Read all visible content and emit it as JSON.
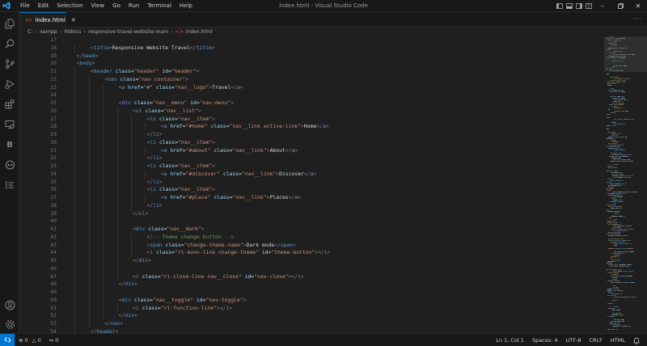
{
  "titlebar": {
    "menu": [
      "File",
      "Edit",
      "Selection",
      "View",
      "Go",
      "Run",
      "Terminal",
      "Help"
    ],
    "window_title": "index.html - Visual Studio Code"
  },
  "tabs": [
    {
      "label": "index.html",
      "active": true
    }
  ],
  "breadcrumb": [
    "C:",
    "xampp",
    "htdocs",
    "responsive-travel-website-main",
    "index.html"
  ],
  "editor": {
    "line_numbers": [
      "17",
      "18",
      "19",
      "20",
      "21",
      "22",
      "23",
      "24",
      "25",
      "26",
      "27",
      "28",
      "29",
      "30",
      "31",
      "32",
      "33",
      "34",
      "35",
      "36",
      "37",
      "38",
      "39",
      "40",
      "41",
      "42",
      "43",
      "44",
      "45",
      "46",
      "47",
      "48",
      "49",
      "50",
      "51",
      "52",
      "53",
      "54"
    ],
    "lines": [
      {
        "indent": 0,
        "tokens": []
      },
      {
        "indent": 2,
        "tokens": [
          [
            "br",
            "<"
          ],
          [
            "tag",
            "title"
          ],
          [
            "br",
            ">"
          ],
          [
            "txt",
            "Responsive Website Travel"
          ],
          [
            "br",
            "</"
          ],
          [
            "tag",
            "title"
          ],
          [
            "br",
            ">"
          ]
        ]
      },
      {
        "indent": 1,
        "tokens": [
          [
            "br",
            "</"
          ],
          [
            "tag",
            "head"
          ],
          [
            "br",
            ">"
          ]
        ]
      },
      {
        "indent": 1,
        "tokens": [
          [
            "br",
            "<"
          ],
          [
            "tag",
            "body"
          ],
          [
            "br",
            ">"
          ]
        ]
      },
      {
        "indent": 2,
        "tokens": [
          [
            "br",
            "<"
          ],
          [
            "tag",
            "header"
          ],
          [
            "txt",
            " "
          ],
          [
            "attr",
            "class"
          ],
          [
            "eq",
            "="
          ],
          [
            "str",
            "\"header\""
          ],
          [
            "txt",
            " "
          ],
          [
            "attr",
            "id"
          ],
          [
            "eq",
            "="
          ],
          [
            "str",
            "\"header\""
          ],
          [
            "br",
            ">"
          ]
        ]
      },
      {
        "indent": 3,
        "tokens": [
          [
            "br",
            "<"
          ],
          [
            "tag",
            "nav"
          ],
          [
            "txt",
            " "
          ],
          [
            "attr",
            "class"
          ],
          [
            "eq",
            "="
          ],
          [
            "str",
            "\"nav container\""
          ],
          [
            "br",
            ">"
          ]
        ]
      },
      {
        "indent": 4,
        "tokens": [
          [
            "br",
            "<"
          ],
          [
            "tag",
            "a"
          ],
          [
            "txt",
            " "
          ],
          [
            "attr",
            "href"
          ],
          [
            "eq",
            "="
          ],
          [
            "str",
            "\"#\""
          ],
          [
            "txt",
            " "
          ],
          [
            "attr",
            "class"
          ],
          [
            "eq",
            "="
          ],
          [
            "str",
            "\"nav__logo\""
          ],
          [
            "br",
            ">"
          ],
          [
            "txt",
            "Travel"
          ],
          [
            "br",
            "</"
          ],
          [
            "tag",
            "a"
          ],
          [
            "br",
            ">"
          ]
        ]
      },
      {
        "indent": 0,
        "tokens": []
      },
      {
        "indent": 4,
        "tokens": [
          [
            "br",
            "<"
          ],
          [
            "tag",
            "div"
          ],
          [
            "txt",
            " "
          ],
          [
            "attr",
            "class"
          ],
          [
            "eq",
            "="
          ],
          [
            "str",
            "\"nav__menu\""
          ],
          [
            "txt",
            " "
          ],
          [
            "attr",
            "id"
          ],
          [
            "eq",
            "="
          ],
          [
            "str",
            "\"nav-menu\""
          ],
          [
            "br",
            ">"
          ]
        ]
      },
      {
        "indent": 5,
        "tokens": [
          [
            "br",
            "<"
          ],
          [
            "tag",
            "ul"
          ],
          [
            "txt",
            " "
          ],
          [
            "attr",
            "class"
          ],
          [
            "eq",
            "="
          ],
          [
            "str",
            "\"nav__list\""
          ],
          [
            "br",
            ">"
          ]
        ]
      },
      {
        "indent": 6,
        "tokens": [
          [
            "br",
            "<"
          ],
          [
            "tag",
            "li"
          ],
          [
            "txt",
            " "
          ],
          [
            "attr",
            "class"
          ],
          [
            "eq",
            "="
          ],
          [
            "str",
            "\"nav__item\""
          ],
          [
            "br",
            ">"
          ]
        ]
      },
      {
        "indent": 7,
        "tokens": [
          [
            "br",
            "<"
          ],
          [
            "tag",
            "a"
          ],
          [
            "txt",
            " "
          ],
          [
            "attr",
            "href"
          ],
          [
            "eq",
            "="
          ],
          [
            "str",
            "\"#home\""
          ],
          [
            "txt",
            " "
          ],
          [
            "attr",
            "class"
          ],
          [
            "eq",
            "="
          ],
          [
            "str",
            "\"nav__link active-link\""
          ],
          [
            "br",
            ">"
          ],
          [
            "txt",
            "Home"
          ],
          [
            "br",
            "</"
          ],
          [
            "tag",
            "a"
          ],
          [
            "br",
            ">"
          ]
        ]
      },
      {
        "indent": 6,
        "tokens": [
          [
            "br",
            "</"
          ],
          [
            "tag",
            "li"
          ],
          [
            "br",
            ">"
          ]
        ]
      },
      {
        "indent": 6,
        "tokens": [
          [
            "br",
            "<"
          ],
          [
            "tag",
            "li"
          ],
          [
            "txt",
            " "
          ],
          [
            "attr",
            "class"
          ],
          [
            "eq",
            "="
          ],
          [
            "str",
            "\"nav__item\""
          ],
          [
            "br",
            ">"
          ]
        ]
      },
      {
        "indent": 7,
        "tokens": [
          [
            "br",
            "<"
          ],
          [
            "tag",
            "a"
          ],
          [
            "txt",
            " "
          ],
          [
            "attr",
            "href"
          ],
          [
            "eq",
            "="
          ],
          [
            "str",
            "\"#about\""
          ],
          [
            "txt",
            " "
          ],
          [
            "attr",
            "class"
          ],
          [
            "eq",
            "="
          ],
          [
            "str",
            "\"nav__link\""
          ],
          [
            "br",
            ">"
          ],
          [
            "txt",
            "About"
          ],
          [
            "br",
            "</"
          ],
          [
            "tag",
            "a"
          ],
          [
            "br",
            ">"
          ]
        ]
      },
      {
        "indent": 6,
        "tokens": [
          [
            "br",
            "</"
          ],
          [
            "tag",
            "li"
          ],
          [
            "br",
            ">"
          ]
        ]
      },
      {
        "indent": 6,
        "tokens": [
          [
            "br",
            "<"
          ],
          [
            "tag",
            "li"
          ],
          [
            "txt",
            " "
          ],
          [
            "attr",
            "class"
          ],
          [
            "eq",
            "="
          ],
          [
            "str",
            "\"nav__item\""
          ],
          [
            "br",
            ">"
          ]
        ]
      },
      {
        "indent": 7,
        "tokens": [
          [
            "br",
            "<"
          ],
          [
            "tag",
            "a"
          ],
          [
            "txt",
            " "
          ],
          [
            "attr",
            "href"
          ],
          [
            "eq",
            "="
          ],
          [
            "str",
            "\"#discover\""
          ],
          [
            "txt",
            " "
          ],
          [
            "attr",
            "class"
          ],
          [
            "eq",
            "="
          ],
          [
            "str",
            "\"nav__link\""
          ],
          [
            "br",
            ">"
          ],
          [
            "txt",
            "Discover"
          ],
          [
            "br",
            "</"
          ],
          [
            "tag",
            "a"
          ],
          [
            "br",
            ">"
          ]
        ]
      },
      {
        "indent": 6,
        "tokens": [
          [
            "br",
            "</"
          ],
          [
            "tag",
            "li"
          ],
          [
            "br",
            ">"
          ]
        ]
      },
      {
        "indent": 6,
        "tokens": [
          [
            "br",
            "<"
          ],
          [
            "tag",
            "li"
          ],
          [
            "txt",
            " "
          ],
          [
            "attr",
            "class"
          ],
          [
            "eq",
            "="
          ],
          [
            "str",
            "\"nav__item\""
          ],
          [
            "br",
            ">"
          ]
        ]
      },
      {
        "indent": 7,
        "tokens": [
          [
            "br",
            "<"
          ],
          [
            "tag",
            "a"
          ],
          [
            "txt",
            " "
          ],
          [
            "attr",
            "href"
          ],
          [
            "eq",
            "="
          ],
          [
            "str",
            "\"#place\""
          ],
          [
            "txt",
            " "
          ],
          [
            "attr",
            "class"
          ],
          [
            "eq",
            "="
          ],
          [
            "str",
            "\"nav__link\""
          ],
          [
            "br",
            ">"
          ],
          [
            "txt",
            "Places"
          ],
          [
            "br",
            "</"
          ],
          [
            "tag",
            "a"
          ],
          [
            "br",
            ">"
          ]
        ]
      },
      {
        "indent": 6,
        "tokens": [
          [
            "br",
            "</"
          ],
          [
            "tag",
            "li"
          ],
          [
            "br",
            ">"
          ]
        ]
      },
      {
        "indent": 5,
        "tokens": [
          [
            "br",
            "</"
          ],
          [
            "tag",
            "ul"
          ],
          [
            "br",
            ">"
          ]
        ]
      },
      {
        "indent": 0,
        "tokens": []
      },
      {
        "indent": 5,
        "tokens": [
          [
            "br",
            "<"
          ],
          [
            "tag",
            "div"
          ],
          [
            "txt",
            " "
          ],
          [
            "attr",
            "class"
          ],
          [
            "eq",
            "="
          ],
          [
            "str",
            "\"nav__dark\""
          ],
          [
            "br",
            ">"
          ]
        ]
      },
      {
        "indent": 6,
        "tokens": [
          [
            "com",
            "<!-- Theme change button -->"
          ]
        ]
      },
      {
        "indent": 6,
        "tokens": [
          [
            "br",
            "<"
          ],
          [
            "tag",
            "span"
          ],
          [
            "txt",
            " "
          ],
          [
            "attr",
            "class"
          ],
          [
            "eq",
            "="
          ],
          [
            "str",
            "\"change-theme-name\""
          ],
          [
            "br",
            ">"
          ],
          [
            "txt",
            "Dark mode"
          ],
          [
            "br",
            "</"
          ],
          [
            "tag",
            "span"
          ],
          [
            "br",
            ">"
          ]
        ]
      },
      {
        "indent": 6,
        "tokens": [
          [
            "br",
            "<"
          ],
          [
            "tag",
            "i"
          ],
          [
            "txt",
            " "
          ],
          [
            "attr",
            "class"
          ],
          [
            "eq",
            "="
          ],
          [
            "str",
            "\"ri-moon-line change-theme\""
          ],
          [
            "txt",
            " "
          ],
          [
            "attr",
            "id"
          ],
          [
            "eq",
            "="
          ],
          [
            "str",
            "\"theme-button\""
          ],
          [
            "br",
            ">"
          ],
          [
            "br",
            "</"
          ],
          [
            "tag",
            "i"
          ],
          [
            "br",
            ">"
          ]
        ]
      },
      {
        "indent": 5,
        "tokens": [
          [
            "br",
            "</"
          ],
          [
            "tag",
            "div"
          ],
          [
            "br",
            ">"
          ]
        ]
      },
      {
        "indent": 0,
        "tokens": []
      },
      {
        "indent": 5,
        "tokens": [
          [
            "br",
            "<"
          ],
          [
            "tag",
            "i"
          ],
          [
            "txt",
            " "
          ],
          [
            "attr",
            "class"
          ],
          [
            "eq",
            "="
          ],
          [
            "str",
            "\"ri-close-line nav__close\""
          ],
          [
            "txt",
            " "
          ],
          [
            "attr",
            "id"
          ],
          [
            "eq",
            "="
          ],
          [
            "str",
            "\"nav-close\""
          ],
          [
            "br",
            ">"
          ],
          [
            "br",
            "</"
          ],
          [
            "tag",
            "i"
          ],
          [
            "br",
            ">"
          ]
        ]
      },
      {
        "indent": 4,
        "tokens": [
          [
            "br",
            "</"
          ],
          [
            "tag",
            "div"
          ],
          [
            "br",
            ">"
          ]
        ]
      },
      {
        "indent": 0,
        "tokens": []
      },
      {
        "indent": 4,
        "tokens": [
          [
            "br",
            "<"
          ],
          [
            "tag",
            "div"
          ],
          [
            "txt",
            " "
          ],
          [
            "attr",
            "class"
          ],
          [
            "eq",
            "="
          ],
          [
            "str",
            "\"nav__toggle\""
          ],
          [
            "txt",
            " "
          ],
          [
            "attr",
            "id"
          ],
          [
            "eq",
            "="
          ],
          [
            "str",
            "\"nav-toggle\""
          ],
          [
            "br",
            ">"
          ]
        ]
      },
      {
        "indent": 5,
        "tokens": [
          [
            "br",
            "<"
          ],
          [
            "tag",
            "i"
          ],
          [
            "txt",
            " "
          ],
          [
            "attr",
            "class"
          ],
          [
            "eq",
            "="
          ],
          [
            "str",
            "\"ri-function-line\""
          ],
          [
            "br",
            ">"
          ],
          [
            "br",
            "</"
          ],
          [
            "tag",
            "i"
          ],
          [
            "br",
            ">"
          ]
        ]
      },
      {
        "indent": 4,
        "tokens": [
          [
            "br",
            "</"
          ],
          [
            "tag",
            "div"
          ],
          [
            "br",
            ">"
          ]
        ]
      },
      {
        "indent": 3,
        "tokens": [
          [
            "br",
            "</"
          ],
          [
            "tag",
            "nav"
          ],
          [
            "br",
            ">"
          ]
        ]
      },
      {
        "indent": 2,
        "tokens": [
          [
            "br",
            "</"
          ],
          [
            "tag",
            "header"
          ],
          [
            "br",
            ">"
          ]
        ]
      }
    ]
  },
  "statusbar": {
    "errors": "0",
    "warnings": "0",
    "ports": "0",
    "position": "Ln 1, Col 1",
    "spaces": "Spaces: 4",
    "encoding": "UTF-8",
    "eol": "CRLF",
    "language": "HTML"
  },
  "colors": {
    "accent": "#0078d4",
    "tag": "#569cd6",
    "attr": "#9cdcfe",
    "string": "#ce9178",
    "comment": "#6a9955"
  }
}
